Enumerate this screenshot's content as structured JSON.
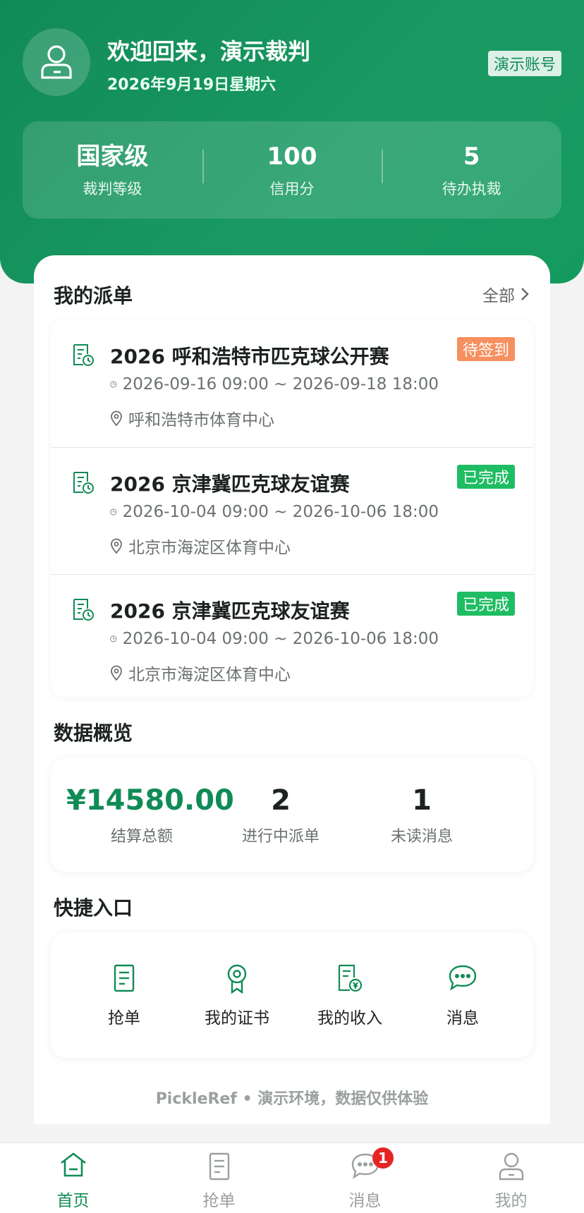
{
  "header": {
    "welcome": "欢迎回来，演示裁判",
    "date": "2026年9月19日星期六",
    "demo_badge": "演示账号",
    "stats": [
      {
        "value": "国家级",
        "label": "裁判等级"
      },
      {
        "value": "100",
        "label": "信用分"
      },
      {
        "value": "5",
        "label": "待办执裁"
      }
    ]
  },
  "orders": {
    "title": "我的派单",
    "all_link": "全部",
    "items": [
      {
        "name": "2026 呼和浩特市匹克球公开赛",
        "status": "待签到",
        "status_color": "#f6905f",
        "time": "2026-09-16 09:00 ~ 2026-09-18 18:00",
        "place": "呼和浩特市体育中心"
      },
      {
        "name": "2026 京津冀匹克球友谊赛",
        "status": "已完成",
        "status_color": "#1fbd63",
        "time": "2026-10-04 09:00 ~ 2026-10-06 18:00",
        "place": "北京市海淀区体育中心"
      },
      {
        "name": "2026 京津冀匹克球友谊赛",
        "status": "已完成",
        "status_color": "#1fbd63",
        "time": "2026-10-04 09:00 ~ 2026-10-06 18:00",
        "place": "北京市海淀区体育中心"
      }
    ]
  },
  "overview": {
    "title": "数据概览",
    "items": [
      {
        "value": "¥14580.00",
        "label": "结算总额"
      },
      {
        "value": "2",
        "label": "进行中派单"
      },
      {
        "value": "1",
        "label": "未读消息"
      }
    ]
  },
  "quick": {
    "title": "快捷入口",
    "items": [
      {
        "label": "抢单",
        "icon": "document-icon"
      },
      {
        "label": "我的证书",
        "icon": "certificate-icon"
      },
      {
        "label": "我的收入",
        "icon": "income-icon"
      },
      {
        "label": "消息",
        "icon": "chat-icon"
      }
    ]
  },
  "footer_note": "PickleRef • 演示环境，数据仅供体验",
  "tabbar": {
    "items": [
      {
        "label": "首页",
        "icon": "home-icon",
        "active": true
      },
      {
        "label": "抢单",
        "icon": "document-icon"
      },
      {
        "label": "消息",
        "icon": "chat-icon",
        "badge": "1"
      },
      {
        "label": "我的",
        "icon": "user-icon"
      }
    ]
  },
  "colors": {
    "brand": "#118b56",
    "pending": "#f6905f",
    "done": "#1fbd63",
    "badge": "#e52424"
  }
}
